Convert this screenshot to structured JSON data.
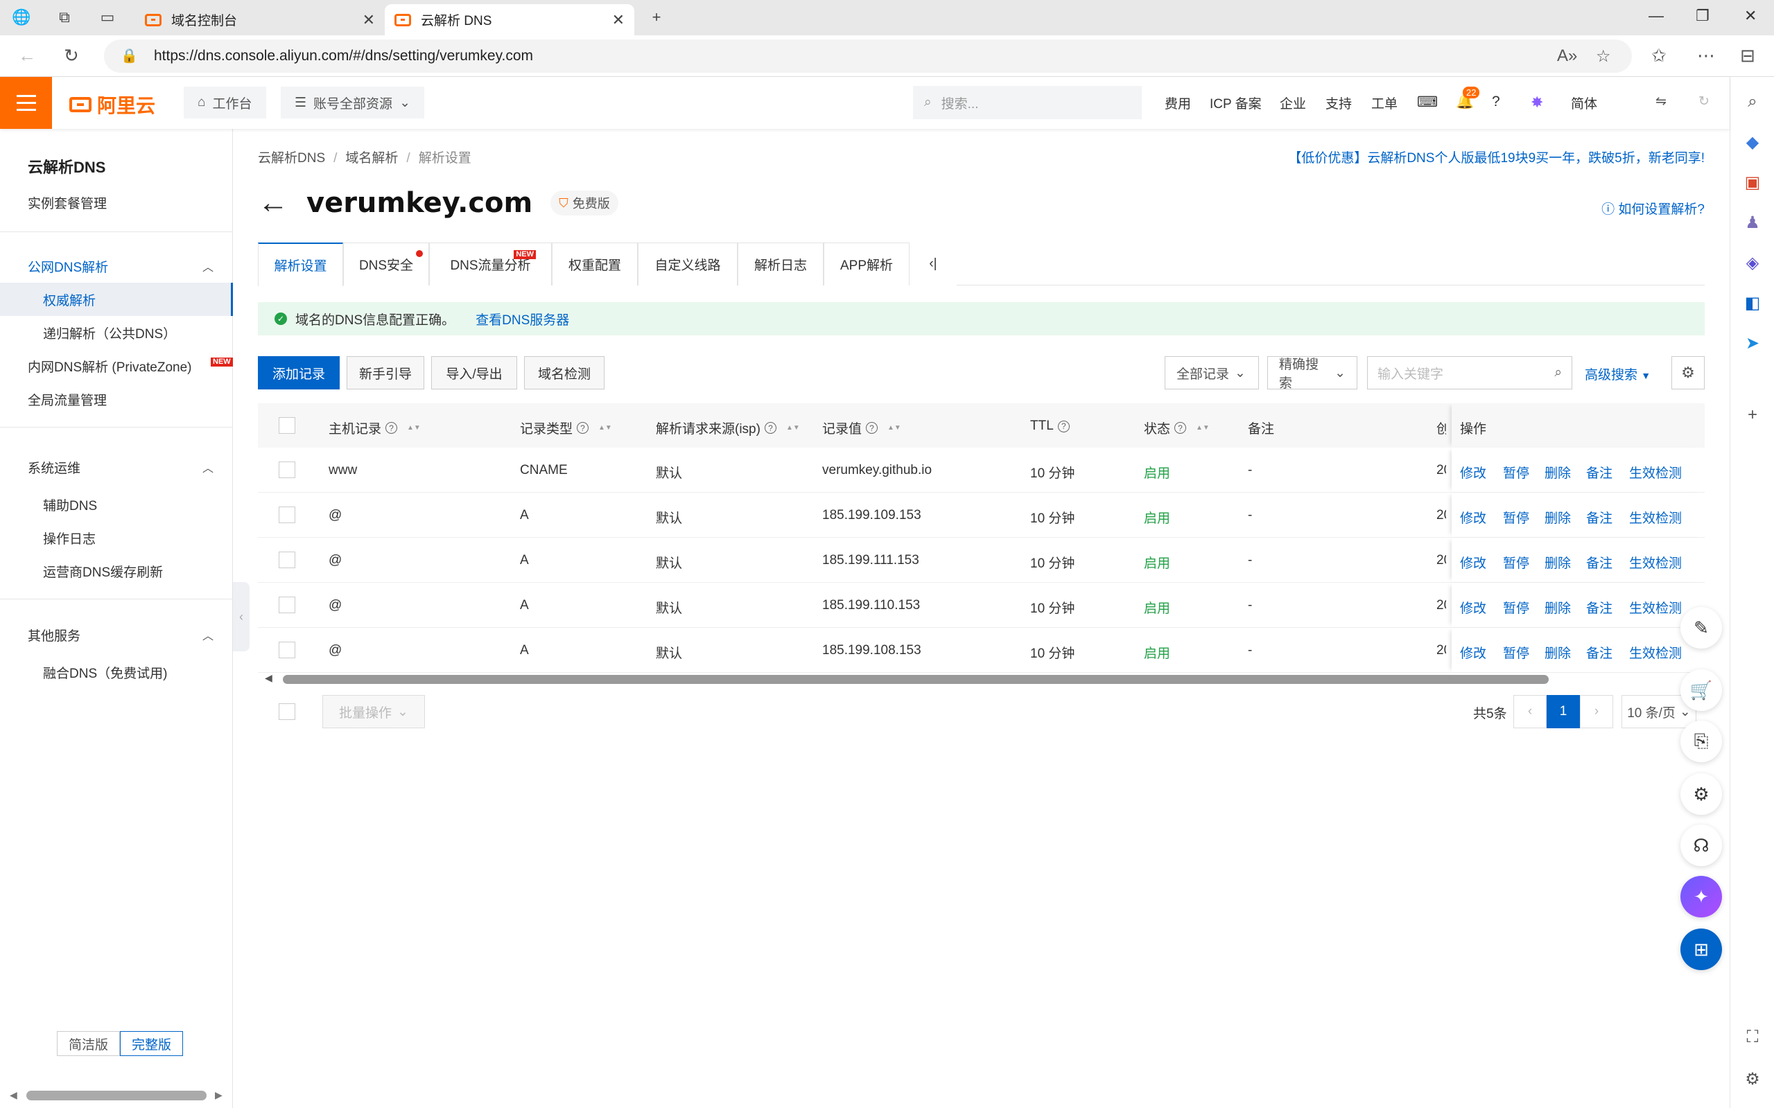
{
  "browser": {
    "tabs": [
      {
        "title": "域名控制台",
        "active": false
      },
      {
        "title": "云解析 DNS",
        "active": true
      }
    ],
    "url": "https://dns.console.aliyun.com/#/dns/setting/verumkey.com"
  },
  "topnav": {
    "logo": "阿里云",
    "workbench": "工作台",
    "resources": "账号全部资源",
    "search_placeholder": "搜索...",
    "links": [
      "费用",
      "ICP 备案",
      "企业",
      "支持",
      "工单"
    ],
    "notification_count": "22",
    "lang": "简体"
  },
  "sidebar": {
    "title": "云解析DNS",
    "instance": "实例套餐管理",
    "group1": "公网DNS解析",
    "authoritative": "权威解析",
    "recursive": "递归解析（公共DNS）",
    "private_zone": "内网DNS解析 (PrivateZone)",
    "gtm": "全局流量管理",
    "group2": "系统运维",
    "aux_dns": "辅助DNS",
    "oplog": "操作日志",
    "isp_refresh": "运营商DNS缓存刷新",
    "group3": "其他服务",
    "fusion_dns": "融合DNS（免费试用)",
    "simple": "简洁版",
    "full": "完整版",
    "new_tag": "NEW"
  },
  "breadcrumb": [
    "云解析DNS",
    "域名解析",
    "解析设置"
  ],
  "promo": "【低价优惠】云解析DNS个人版最低19块9买一年，跌破5折，新老同享!",
  "domain": "verumkey.com",
  "edition": "免费版",
  "howto": "如何设置解析?",
  "tabs": [
    "解析设置",
    "DNS安全",
    "DNS流量分析",
    "权重配置",
    "自定义线路",
    "解析日志",
    "APP解析"
  ],
  "alert": {
    "text": "域名的DNS信息配置正确。",
    "link": "查看DNS服务器"
  },
  "toolbar": {
    "add": "添加记录",
    "guide": "新手引导",
    "import_export": "导入/导出",
    "check": "域名检测",
    "all_records": "全部记录",
    "exact_search": "精确搜索",
    "keyword_placeholder": "输入关键字",
    "advanced": "高级搜索"
  },
  "table": {
    "columns": [
      "主机记录",
      "记录类型",
      "解析请求来源(isp)",
      "记录值",
      "TTL",
      "状态",
      "备注",
      "操作"
    ],
    "rows": [
      {
        "host": "www",
        "type": "CNAME",
        "line": "默认",
        "value": "verumkey.github.io",
        "ttl": "10 分钟",
        "status": "启用",
        "remark": "-"
      },
      {
        "host": "@",
        "type": "A",
        "line": "默认",
        "value": "185.199.109.153",
        "ttl": "10 分钟",
        "status": "启用",
        "remark": "-"
      },
      {
        "host": "@",
        "type": "A",
        "line": "默认",
        "value": "185.199.111.153",
        "ttl": "10 分钟",
        "status": "启用",
        "remark": "-"
      },
      {
        "host": "@",
        "type": "A",
        "line": "默认",
        "value": "185.199.110.153",
        "ttl": "10 分钟",
        "status": "启用",
        "remark": "-"
      },
      {
        "host": "@",
        "type": "A",
        "line": "默认",
        "value": "185.199.108.153",
        "ttl": "10 分钟",
        "status": "启用",
        "remark": "-"
      }
    ],
    "actions": [
      "修改",
      "暂停",
      "删除",
      "备注",
      "生效检测"
    ],
    "trunc_head": "创",
    "trunc_cell": "20"
  },
  "footer": {
    "batch": "批量操作",
    "total": "共5条",
    "page": "1",
    "page_size": "10 条/页"
  }
}
